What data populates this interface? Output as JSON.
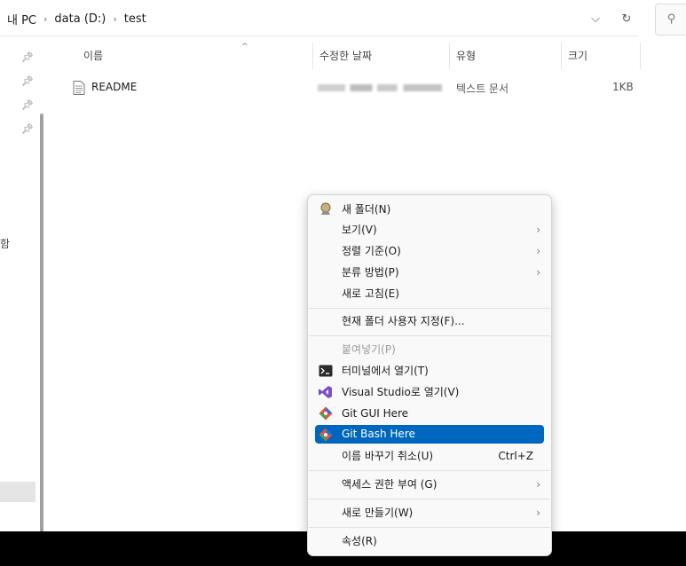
{
  "breadcrumb": [
    "내 PC",
    "data (D:)",
    "test"
  ],
  "columns": {
    "name": "이름",
    "date": "수정한 날짜",
    "type": "유형",
    "size": "크기"
  },
  "file": {
    "name": "README",
    "type": "텍스트 문서",
    "size": "1KB"
  },
  "nav": {
    "partial_char": "함"
  },
  "menu": {
    "new_folder": "새 폴더(N)",
    "view": "보기(V)",
    "sort_by": "정렬 기준(O)",
    "group_by": "분류 방법(P)",
    "refresh": "새로 고침(E)",
    "customize": "현재 폴더 사용자 지정(F)...",
    "paste": "붙여넣기(P)",
    "open_terminal": "터미널에서 열기(T)",
    "open_vs": "Visual Studio로 열기(V)",
    "git_gui": "Git GUI Here",
    "git_bash": "Git Bash Here",
    "undo_rename": "이름 바꾸기 취소(U)",
    "undo_shortcut": "Ctrl+Z",
    "give_access": "액세스 권한 부여 (G)",
    "new": "새로 만들기(W)",
    "properties": "속성(R)"
  },
  "colors": {
    "highlight": "#0067c0",
    "menu_bg": "#f9f9f9"
  }
}
